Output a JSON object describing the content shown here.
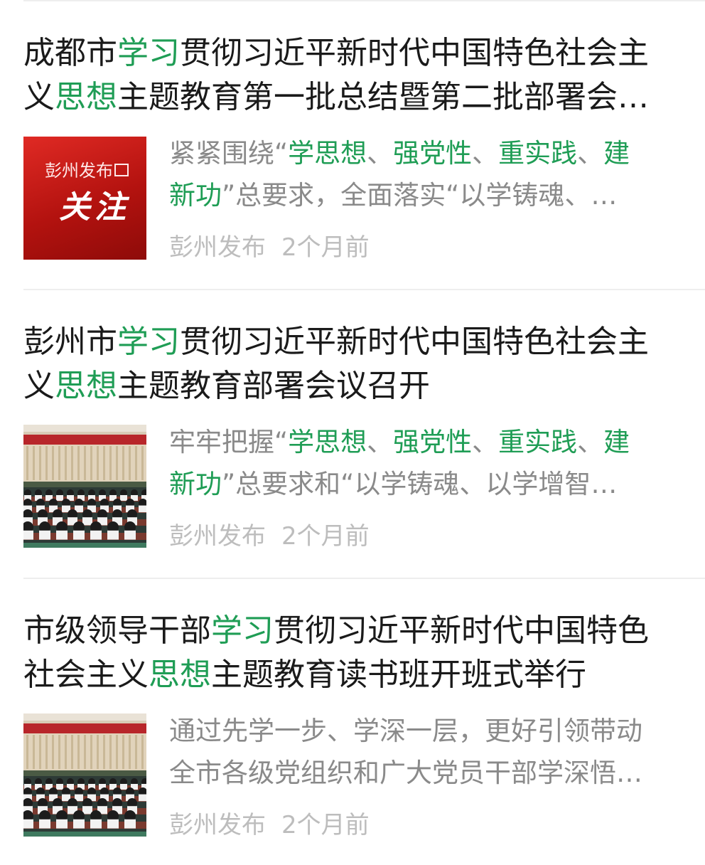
{
  "colors": {
    "highlight": "#1f9d55",
    "title": "#1a1a1a",
    "summary": "#8a8a8a",
    "meta": "#bdbdbd"
  },
  "articles": [
    {
      "title_lines": [
        [
          {
            "t": "成都市"
          },
          {
            "t": "学习",
            "hl": true
          },
          {
            "t": "贯彻习近平新时代中国特色社会主"
          }
        ],
        [
          {
            "t": "义"
          },
          {
            "t": "思想",
            "hl": true
          },
          {
            "t": "主题教育第一批总结暨第二批部署会…"
          }
        ]
      ],
      "summary_lines": [
        [
          {
            "t": "紧紧围绕“"
          },
          {
            "t": "学思想",
            "hl": true
          },
          {
            "t": "、"
          },
          {
            "t": "强党性",
            "hl": true
          },
          {
            "t": "、"
          },
          {
            "t": "重实践",
            "hl": true
          },
          {
            "t": "、"
          },
          {
            "t": "建",
            "hl": true
          }
        ],
        [
          {
            "t": "新功",
            "hl": true
          },
          {
            "t": "”总要求，全面落实“以学铸魂、…"
          }
        ]
      ],
      "thumbnail": {
        "kind": "banner",
        "brand": "彭州发布",
        "headline": "关注"
      },
      "source": "彭州发布",
      "time": "2个月前"
    },
    {
      "title_lines": [
        [
          {
            "t": "彭州市"
          },
          {
            "t": "学习",
            "hl": true
          },
          {
            "t": "贯彻习近平新时代中国特色社会主"
          }
        ],
        [
          {
            "t": "义"
          },
          {
            "t": "思想",
            "hl": true
          },
          {
            "t": "主题教育部署会议召开"
          }
        ]
      ],
      "summary_lines": [
        [
          {
            "t": "牢牢把握“"
          },
          {
            "t": "学思想",
            "hl": true
          },
          {
            "t": "、"
          },
          {
            "t": "强党性",
            "hl": true
          },
          {
            "t": "、"
          },
          {
            "t": "重实践",
            "hl": true
          },
          {
            "t": "、"
          },
          {
            "t": "建",
            "hl": true
          }
        ],
        [
          {
            "t": "新功",
            "hl": true
          },
          {
            "t": "”总要求和“以学铸魂、以学增智…"
          }
        ]
      ],
      "thumbnail": {
        "kind": "meeting-photo"
      },
      "source": "彭州发布",
      "time": "2个月前"
    },
    {
      "title_lines": [
        [
          {
            "t": "市级领导干部"
          },
          {
            "t": "学习",
            "hl": true
          },
          {
            "t": "贯彻习近平新时代中国特色"
          }
        ],
        [
          {
            "t": "社会主义"
          },
          {
            "t": "思想",
            "hl": true
          },
          {
            "t": "主题教育读书班开班式举行"
          }
        ]
      ],
      "summary_lines": [
        [
          {
            "t": "通过先学一步、学深一层，更好引领带动"
          }
        ],
        [
          {
            "t": "全市各级党组织和广大党员干部学深悟…"
          }
        ]
      ],
      "thumbnail": {
        "kind": "meeting-photo"
      },
      "source": "彭州发布",
      "time": "2个月前"
    }
  ]
}
